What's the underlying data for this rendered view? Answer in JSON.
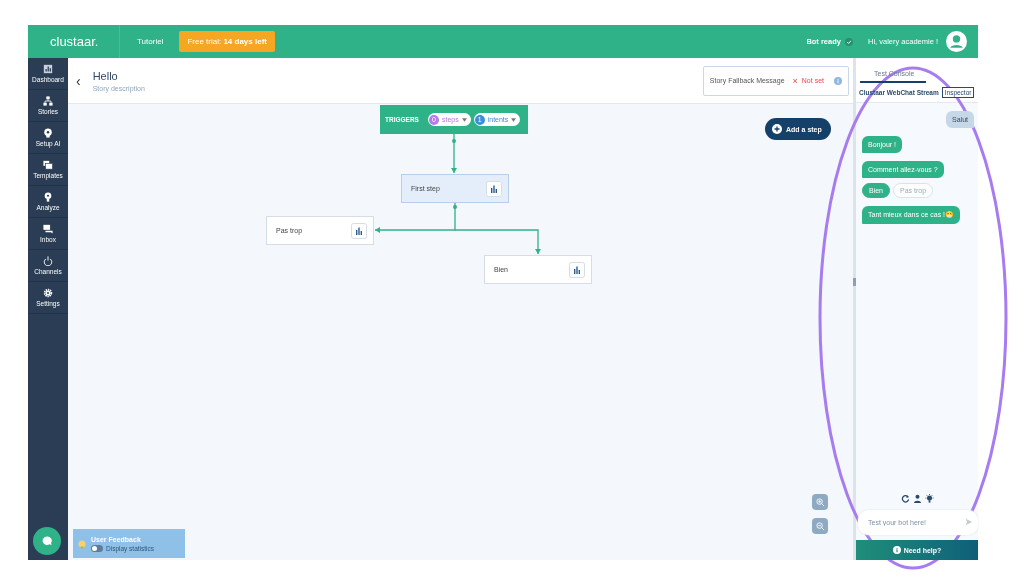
{
  "topbar": {
    "logo": "clustaar.",
    "nav": "Tutoriel",
    "trial": {
      "prefix": "Free trial: ",
      "bold": "14 days left"
    },
    "status": "Bot ready",
    "greeting": "Hi, valery academie !"
  },
  "sidebar": {
    "items": [
      {
        "label": "Dashboard"
      },
      {
        "label": "Stories"
      },
      {
        "label": "Setup AI"
      },
      {
        "label": "Templates"
      },
      {
        "label": "Analyze"
      },
      {
        "label": "Inbox"
      },
      {
        "label": "Channels"
      },
      {
        "label": "Settings"
      }
    ]
  },
  "header": {
    "back": "‹",
    "title": "Hello",
    "description": "Story description",
    "fallback": {
      "label": "Story Fallback Message",
      "status_mark": "×",
      "status": "Not set"
    }
  },
  "canvas": {
    "triggers": {
      "label": "TRIGGERS",
      "chips": [
        {
          "count": "0",
          "label": "steps",
          "color": "#b57be8"
        },
        {
          "count": "1",
          "label": "intents",
          "color": "#3b8fd9"
        }
      ]
    },
    "add_step": "Add a step",
    "steps": [
      {
        "label": "First step",
        "selected": true
      },
      {
        "label": "Pas trop",
        "selected": false
      },
      {
        "label": "Bien",
        "selected": false
      }
    ],
    "feedback": {
      "title": "User Feedback",
      "toggle_label": "Display statistics",
      "on": false
    }
  },
  "console": {
    "tab": "Test Console",
    "stream": "Clustaar WebChat Stream",
    "inspector": "Inspector",
    "messages": [
      {
        "kind": "user",
        "text": "Salut"
      },
      {
        "kind": "bot",
        "text": "Bonjour !"
      },
      {
        "kind": "bot",
        "text": "Comment allez-vous ?"
      },
      {
        "kind": "choices",
        "options": [
          {
            "label": "Bien",
            "selected": true
          },
          {
            "label": "Pas trop",
            "selected": false
          }
        ]
      },
      {
        "kind": "bot",
        "text": "Tant mieux dans ce cas !",
        "emoji": "😁"
      }
    ],
    "input": {
      "placeholder": "Test your bot here!"
    },
    "help": "Need help?"
  }
}
